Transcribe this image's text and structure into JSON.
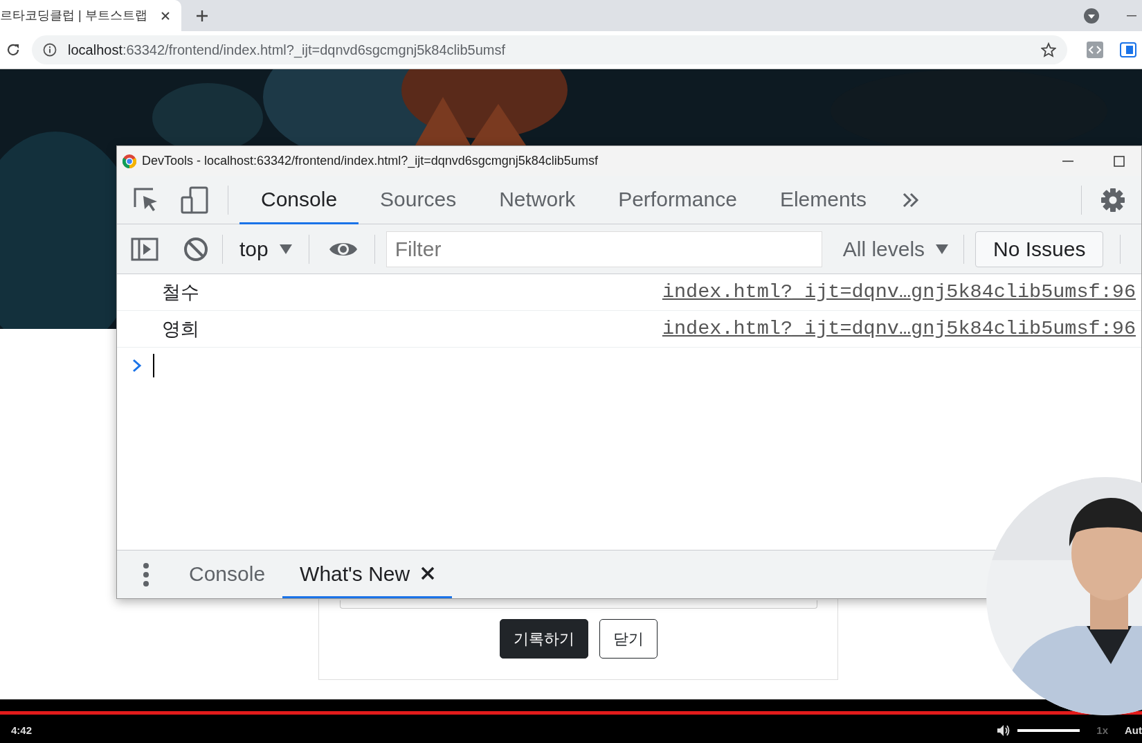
{
  "browser": {
    "tab": {
      "title": "르타코딩클럽 | 부트스트랩"
    },
    "url": {
      "host": "localhost",
      "rest": ":63342/frontend/index.html?_ijt=dqnvd6sgcmgnj5k84clib5umsf"
    }
  },
  "devtools": {
    "title": "DevTools - localhost:63342/frontend/index.html?_ijt=dqnvd6sgcmgnj5k84clib5umsf",
    "tabs": [
      {
        "label": "Console",
        "selected": true
      },
      {
        "label": "Sources",
        "selected": false
      },
      {
        "label": "Network",
        "selected": false
      },
      {
        "label": "Performance",
        "selected": false
      },
      {
        "label": "Elements",
        "selected": false
      }
    ],
    "context": "top",
    "filter": {
      "placeholder": "Filter"
    },
    "levels": "All levels",
    "issues": "No Issues",
    "messages": [
      {
        "text": "철수",
        "source": "index.html?_ijt=dqnv…gnj5k84clib5umsf:96"
      },
      {
        "text": "영희",
        "source": "index.html?_ijt=dqnv…gnj5k84clib5umsf:96"
      }
    ],
    "drawer_tabs": [
      {
        "label": "Console",
        "selected": false,
        "closable": false
      },
      {
        "label": "What's New",
        "selected": true,
        "closable": true
      }
    ]
  },
  "form": {
    "buttons": [
      {
        "label": "기록하기",
        "kind": "primary"
      },
      {
        "label": "닫기",
        "kind": "secondary"
      }
    ]
  },
  "video": {
    "progress": {
      "level": 1
    },
    "time": "4:42",
    "volume": {
      "level": 1
    },
    "speed": "1x",
    "quality": "Aut"
  }
}
